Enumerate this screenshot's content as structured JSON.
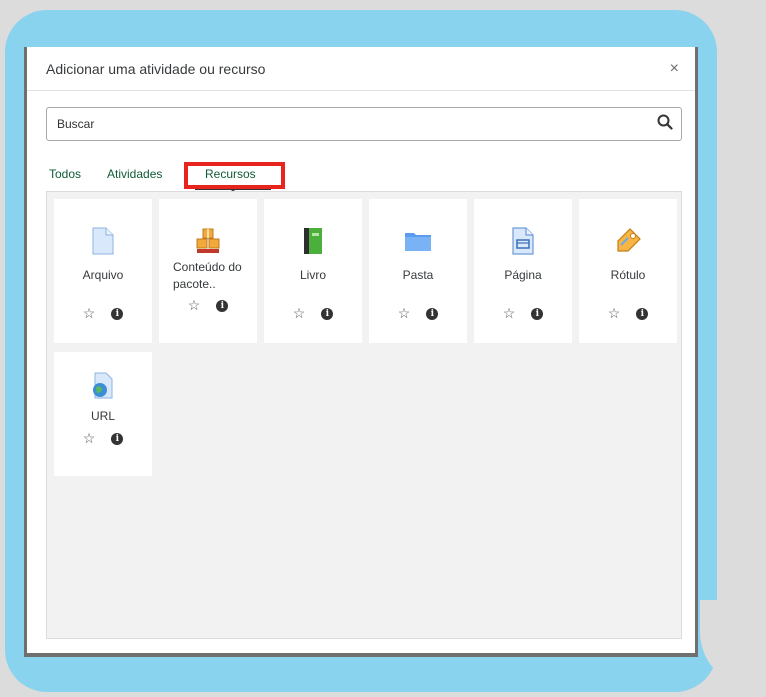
{
  "modal": {
    "title": "Adicionar uma atividade ou recurso",
    "close_symbol": "×"
  },
  "search": {
    "placeholder": "Buscar",
    "icon": "search-icon"
  },
  "tabs": [
    {
      "label": "Todos"
    },
    {
      "label": "Atividades"
    },
    {
      "label": "Recursos",
      "active": true
    }
  ],
  "items": [
    {
      "label": "Arquivo",
      "icon": "file-icon"
    },
    {
      "label": "Conteúdo do pacote..",
      "icon": "package-icon"
    },
    {
      "label": "Livro",
      "icon": "book-icon"
    },
    {
      "label": "Pasta",
      "icon": "folder-icon"
    },
    {
      "label": "Página",
      "icon": "page-icon"
    },
    {
      "label": "Rótulo",
      "icon": "label-tag-icon"
    },
    {
      "label": "URL",
      "icon": "url-icon"
    }
  ],
  "colors": {
    "bubble": "#89d3ee",
    "highlight": "#e8241e",
    "tab_text": "#0f5c35"
  }
}
